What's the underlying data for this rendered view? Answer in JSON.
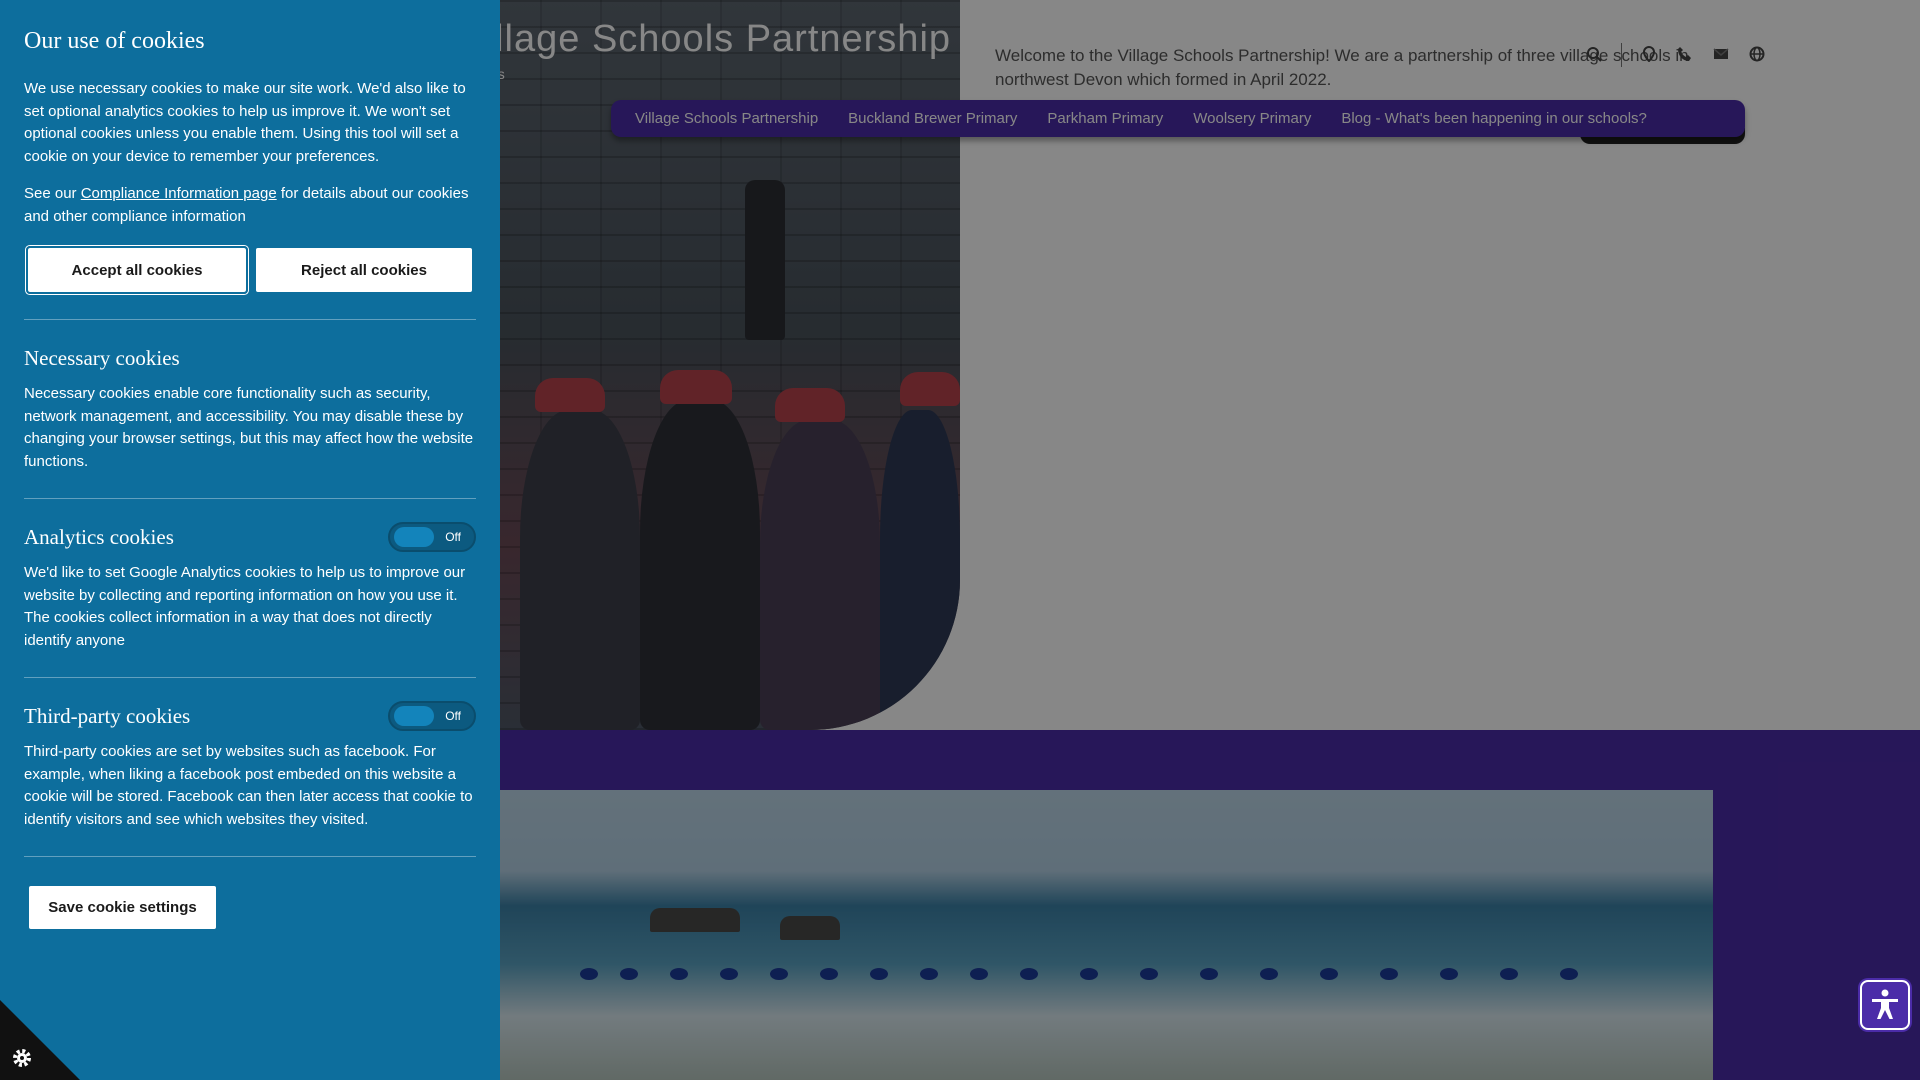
{
  "site": {
    "title": "Village Schools Partnership",
    "subtitle": "es",
    "welcome": "Welcome to the Village Schools Partnership! We are a partnership of three village schools in northwest Devon which formed in April 2022.",
    "header_icons": [
      "search-icon",
      "map-pin-icon",
      "phone-icon",
      "mail-icon",
      "globe-icon"
    ],
    "nav": [
      "Village Schools Partnership",
      "Buckland Brewer Primary",
      "Parkham Primary",
      "Woolsery Primary",
      "Blog - What's been happening in our schools?"
    ],
    "brand_color": "#4b2ca8"
  },
  "cookies": {
    "title": "Our use of cookies",
    "intro": "We use necessary cookies to make our site work. We'd also like to set optional analytics cookies to help us improve it. We won't set optional cookies unless you enable them. Using this tool will set a cookie on your device to remember your preferences.",
    "compliance_prefix": "See our ",
    "compliance_link": "Compliance Information page",
    "compliance_suffix": " for details about our cookies and other compliance information",
    "accept_label": "Accept all cookies",
    "reject_label": "Reject all cookies",
    "necessary_title": "Necessary cookies",
    "necessary_text": "Necessary cookies enable core functionality such as security, network management, and accessibility. You may disable these by changing your browser settings, but this may affect how the website functions.",
    "analytics_title": "Analytics cookies",
    "analytics_state": "Off",
    "analytics_text": "We'd like to set Google Analytics cookies to help us to improve our website by collecting and reporting information on how you use it. The cookies collect information in a way that does not directly identify anyone",
    "thirdparty_title": "Third-party cookies",
    "thirdparty_state": "Off",
    "thirdparty_text": "Third-party cookies are set by websites such as facebook. For example, when liking a facebook post embeded on this website a cookie will be stored. Facebook can then later access that cookie to identify visitors and see which websites they visited.",
    "save_label": "Save cookie settings",
    "panel_color": "#0d6e9d",
    "badge_icon": "cookie-settings-icon"
  },
  "accessibility": {
    "icon": "accessibility-icon"
  }
}
